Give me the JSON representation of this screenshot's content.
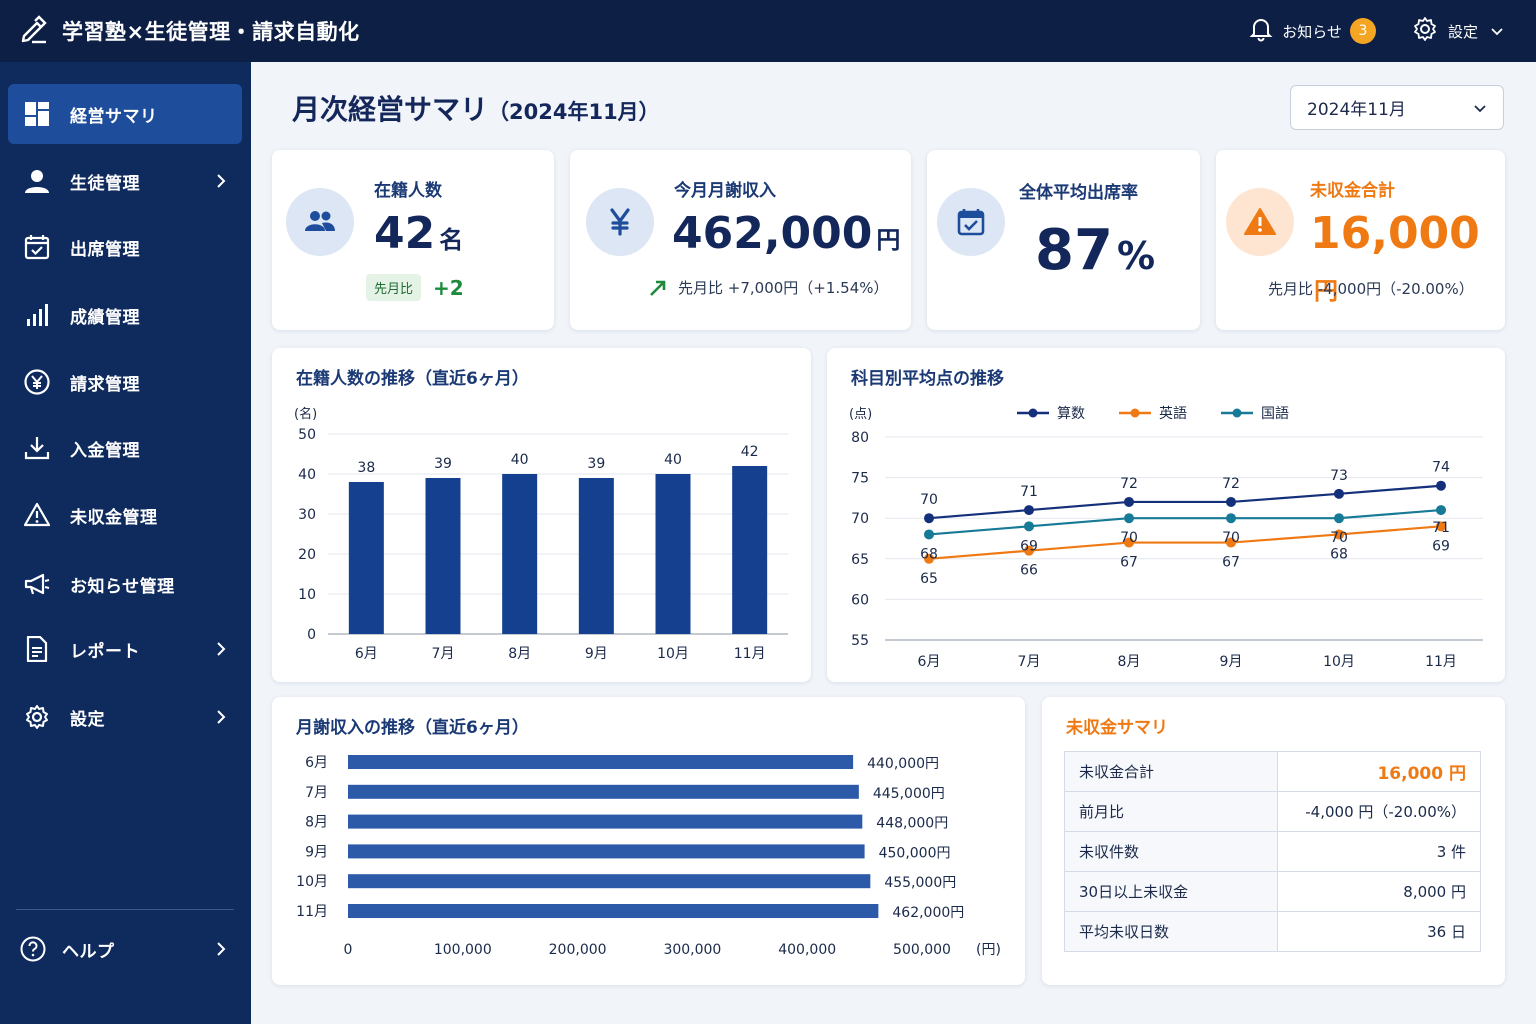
{
  "app": {
    "title": "学習塾×生徒管理・請求自動化"
  },
  "topbar": {
    "notifications_label": "お知らせ",
    "notifications_count": "3",
    "settings_label": "設定"
  },
  "sidebar": {
    "items": [
      {
        "label": "経営サマリ",
        "icon": "dashboard-icon",
        "active": true
      },
      {
        "label": "生徒管理",
        "icon": "person-icon",
        "chevron": true
      },
      {
        "label": "出席管理",
        "icon": "calendar-check-icon"
      },
      {
        "label": "成績管理",
        "icon": "bar-chart-icon"
      },
      {
        "label": "請求管理",
        "icon": "yen-circle-icon"
      },
      {
        "label": "入金管理",
        "icon": "download-icon"
      },
      {
        "label": "未収金管理",
        "icon": "warning-icon"
      },
      {
        "label": "お知らせ管理",
        "icon": "megaphone-icon"
      },
      {
        "label": "レポート",
        "icon": "document-icon",
        "chevron": true
      },
      {
        "label": "設定",
        "icon": "gear-icon",
        "chevron": true
      }
    ],
    "help_label": "ヘルプ"
  },
  "page": {
    "title": "月次経営サマリ",
    "subtitle": "（2024年11月）",
    "month_select": "2024年11月"
  },
  "kpis": {
    "students": {
      "label": "在籍人数",
      "value": "42",
      "unit": "名",
      "compare_label": "先月比",
      "compare_value": "+2"
    },
    "tuition": {
      "label": "今月月謝収入",
      "value": "462,000",
      "unit": "円",
      "compare": "先月比 +7,000円（+1.54%）"
    },
    "attendance": {
      "label": "全体平均出席率",
      "value": "87",
      "unit": "%"
    },
    "unpaid": {
      "label": "未収金合計",
      "value": "16,000",
      "unit": "円",
      "compare": "先月比 -4,000円（-20.00%）"
    }
  },
  "chart_data": [
    {
      "type": "bar",
      "title": "在籍人数の推移（直近6ヶ月）",
      "ylabel": "(名)",
      "categories": [
        "6月",
        "7月",
        "8月",
        "9月",
        "10月",
        "11月"
      ],
      "values": [
        38,
        39,
        40,
        39,
        40,
        42
      ],
      "ylim": [
        0,
        50
      ],
      "yticks": [
        0,
        10,
        20,
        30,
        40,
        50
      ],
      "color": "#14408f",
      "grid": true
    },
    {
      "type": "line",
      "title": "科目別平均点の推移",
      "ylabel": "(点)",
      "categories": [
        "6月",
        "7月",
        "8月",
        "9月",
        "10月",
        "11月"
      ],
      "ylim": [
        55,
        80
      ],
      "yticks": [
        55,
        60,
        65,
        70,
        75,
        80
      ],
      "legend_position": "top",
      "grid": true,
      "series": [
        {
          "name": "算数",
          "values": [
            70,
            71,
            72,
            72,
            73,
            74
          ],
          "color": "#14307a"
        },
        {
          "name": "英語",
          "values": [
            65,
            66,
            67,
            67,
            68,
            69
          ],
          "color": "#ef7a14"
        },
        {
          "name": "国語",
          "values": [
            68,
            69,
            70,
            70,
            70,
            71
          ],
          "color": "#177a96"
        }
      ]
    },
    {
      "type": "bar",
      "orientation": "horizontal",
      "title": "月謝収入の推移（直近6ヶ月）",
      "xlabel": "(円)",
      "categories": [
        "6月",
        "7月",
        "8月",
        "9月",
        "10月",
        "11月"
      ],
      "values": [
        440000,
        445000,
        448000,
        450000,
        455000,
        462000
      ],
      "value_labels": [
        "440,000円",
        "445,000円",
        "448,000円",
        "450,000円",
        "455,000円",
        "462,000円"
      ],
      "xlim": [
        0,
        500000
      ],
      "xticks": [
        "0",
        "100,000",
        "200,000",
        "300,000",
        "400,000",
        "500,000"
      ],
      "color": "#2d5aa8"
    }
  ],
  "unpaid_summary": {
    "title": "未収金サマリ",
    "rows": [
      {
        "label": "未収金合計",
        "value": "16,000 円",
        "highlight": true
      },
      {
        "label": "前月比",
        "value": "-4,000 円（-20.00%）"
      },
      {
        "label": "未収件数",
        "value": "3 件"
      },
      {
        "label": "30日以上未収金",
        "value": "8,000 円"
      },
      {
        "label": "平均未収日数",
        "value": "36 日"
      }
    ]
  }
}
